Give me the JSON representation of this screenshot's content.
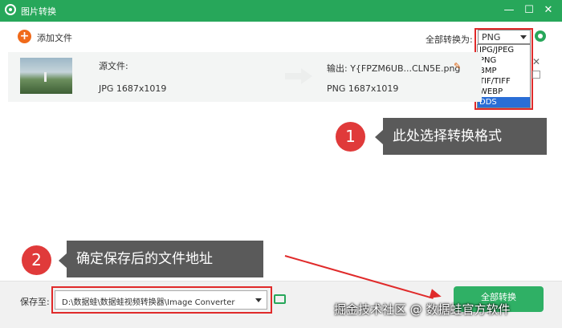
{
  "titlebar": {
    "title": "图片转换",
    "minimize": "—",
    "maximize": "☐",
    "close": "✕"
  },
  "toolbar": {
    "add_files_label": "添加文件",
    "add_icon": "+",
    "convert_all_to_label": "全部转换为:",
    "selected_format": "PNG"
  },
  "format_options": [
    "JPG/JPEG",
    "PNG",
    "BMP",
    "TIF/TIFF",
    "WEBP",
    "DDS"
  ],
  "highlighted_option": "DDS",
  "file": {
    "source_label": "源文件:",
    "source_info": "JPG   1687x1019",
    "output_label": "输出:  Y{FPZM6UB...CLN5E.png",
    "output_info": "PNG   1687x1019",
    "close_symbol": "✕",
    "edit_symbol": "✎"
  },
  "annotations": [
    {
      "number": "1",
      "text": "此处选择转换格式"
    },
    {
      "number": "2",
      "text": "确定保存后的文件地址"
    }
  ],
  "bottom": {
    "save_to_label": "保存至:",
    "save_path": "D:\\数据蛙\\数据蛙视频转换器\\Image Converter",
    "convert_all_button": "全部转换"
  },
  "watermark": "掘金技术社区 @ 数据蛙官方软件",
  "colors": {
    "brand": "#27a75a",
    "annotation_red": "#e02a2a",
    "callout": "#5a5a5a",
    "selection": "#2a6ed6"
  }
}
